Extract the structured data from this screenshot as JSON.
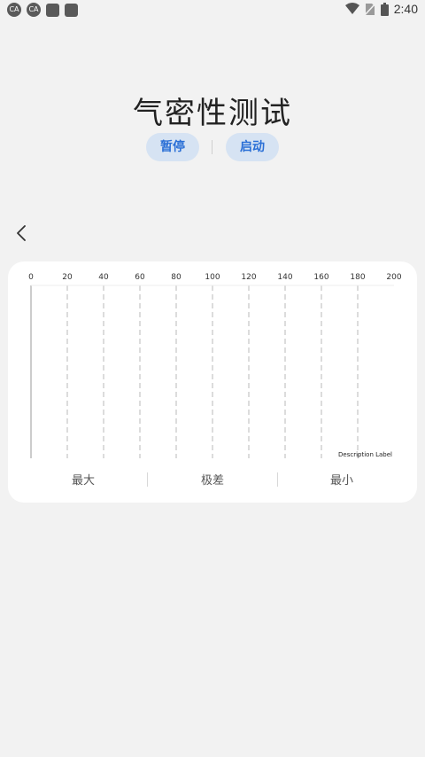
{
  "status_bar": {
    "time": "2:40",
    "app_icon_label": "CA",
    "icons": [
      "app-icon",
      "app-icon",
      "square-notification-icon",
      "square-notification-icon",
      "wifi-icon",
      "no-sim-icon",
      "battery-icon"
    ]
  },
  "page": {
    "title": "气密性测试"
  },
  "buttons": {
    "pause_label": "暂停",
    "start_label": "启动"
  },
  "stats": {
    "max_label": "最大",
    "range_label": "极差",
    "min_label": "最小"
  },
  "chart_data": {
    "type": "line",
    "x_ticks": [
      "0",
      "20",
      "40",
      "60",
      "80",
      "100",
      "120",
      "140",
      "160",
      "180",
      "200"
    ],
    "xlim": [
      0,
      200
    ],
    "grid": "vertical-dashed",
    "description_label": "Description Label",
    "series": []
  },
  "colors": {
    "accent": "#2a6fd6",
    "pill_bg": "#d6e3f3",
    "background": "#f2f2f2",
    "card": "#ffffff"
  }
}
